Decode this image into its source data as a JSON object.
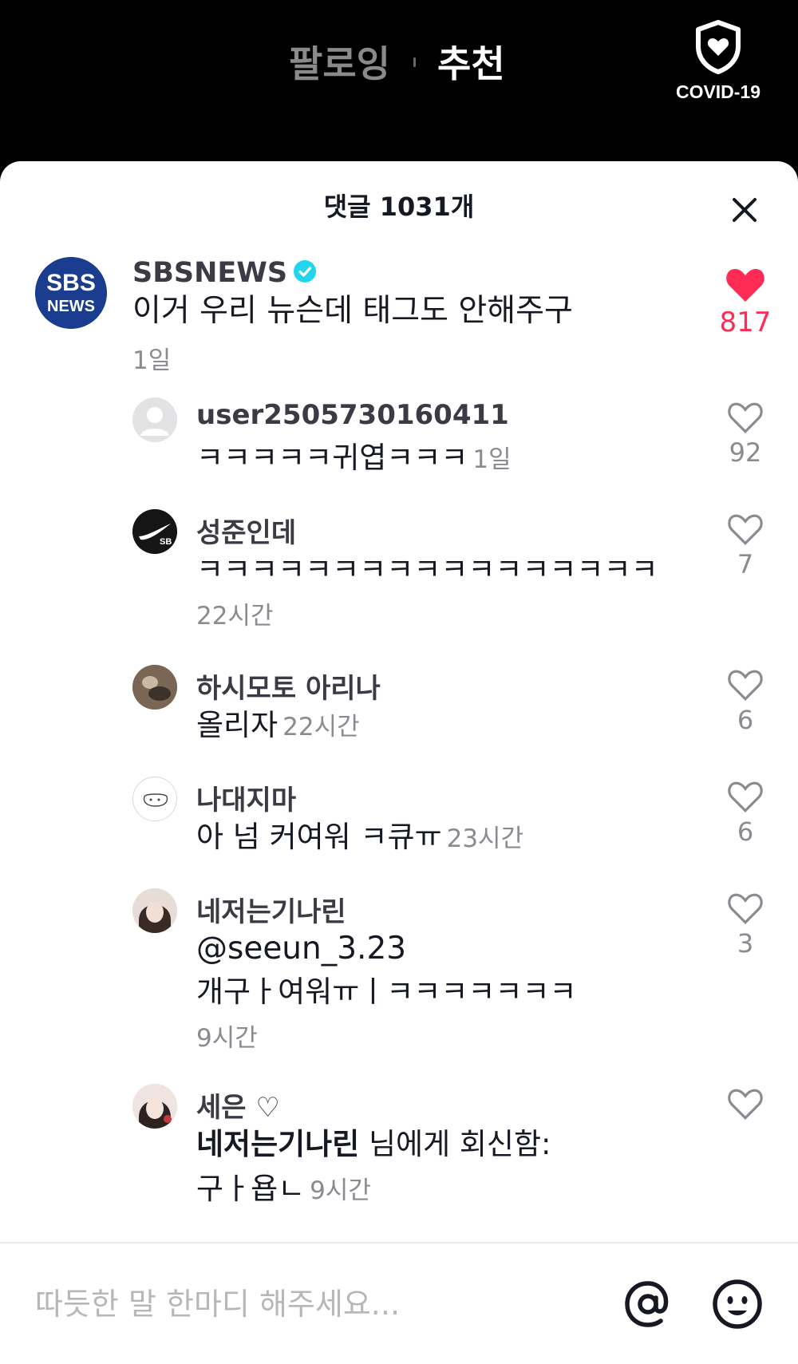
{
  "topbar": {
    "tab_following": "팔로잉",
    "tab_recommend": "추천",
    "covid_label": "COVID-19"
  },
  "sheet": {
    "title": "댓글 1031개"
  },
  "comments": [
    {
      "username": "SBSNEWS",
      "verified": true,
      "avatar_text_1": "SBS",
      "avatar_text_2": "NEWS",
      "text": "이거 우리 뉴슨데 태그도 안해주구",
      "time": "1일",
      "likes": "817",
      "liked": true
    },
    {
      "username": "user2505730160411",
      "text": "ㅋㅋㅋㅋㅋ귀엽ㅋㅋㅋ",
      "time": "1일",
      "likes": "92"
    },
    {
      "username": "성준인데",
      "text": "ㅋㅋㅋㅋㅋㅋㅋㅋㅋㅋㅋㅋㅋㅋㅋㅋㅋ",
      "time": "22시간",
      "likes": "7"
    },
    {
      "username": "하시모토 아리나",
      "text": "올리자",
      "time": "22시간",
      "likes": "6"
    },
    {
      "username": "나대지마",
      "text": "아 넘 커여워 ㅋ큐ㅠ",
      "time": "23시간",
      "likes": "6"
    },
    {
      "username": "네저는기나린",
      "text_line1": "@seeun_3.23",
      "text_line2": "개구ㅏ여워ㅠㅣㅋㅋㅋㅋㅋㅋㅋ",
      "time": "9시간",
      "likes": "3"
    },
    {
      "username": "세은 ♡",
      "reply_target": "네저는기나린",
      "reply_suffix": " 님에게 회신함:",
      "text": "구ㅏ욥ㄴ",
      "time": "9시간",
      "likes": ""
    }
  ],
  "input": {
    "placeholder": "따듯한 말 한마디 해주세요..."
  },
  "icons": {
    "covid": "shield-heart-icon",
    "close": "close-icon",
    "verified": "verified-badge-icon",
    "like": "heart-icon",
    "mention": "at-sign-icon",
    "emoji": "smiley-icon"
  },
  "colors": {
    "like_active": "#fe2c55",
    "verified": "#20d5ec",
    "sbs_blue": "#1a3d8f"
  }
}
